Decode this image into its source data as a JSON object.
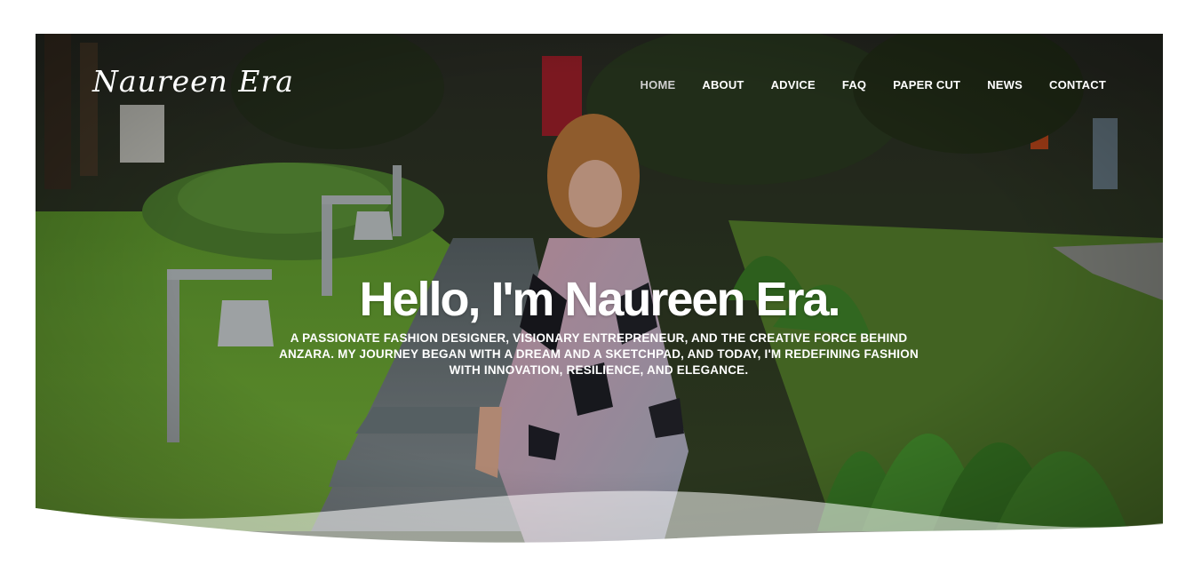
{
  "site": {
    "logo_text": "Naureen Era"
  },
  "nav": {
    "items": [
      {
        "label": "HOME",
        "active": true
      },
      {
        "label": "ABOUT",
        "active": false
      },
      {
        "label": "ADVICE",
        "active": false
      },
      {
        "label": "FAQ",
        "active": false
      },
      {
        "label": "PAPER CUT",
        "active": false
      },
      {
        "label": "NEWS",
        "active": false
      },
      {
        "label": "CONTACT",
        "active": false
      }
    ]
  },
  "hero": {
    "title": "Hello, I'm Naureen Era.",
    "subtitle": "A passionate fashion designer, visionary entrepreneur, and the creative force behind ANZARA. My journey began with a dream and a sketchpad, and today, I'm redefining fashion with innovation, resilience, and elegance."
  },
  "colors": {
    "text": "#ffffff",
    "nav_active": "#cfcfcf",
    "page_background": "#ffffff"
  }
}
